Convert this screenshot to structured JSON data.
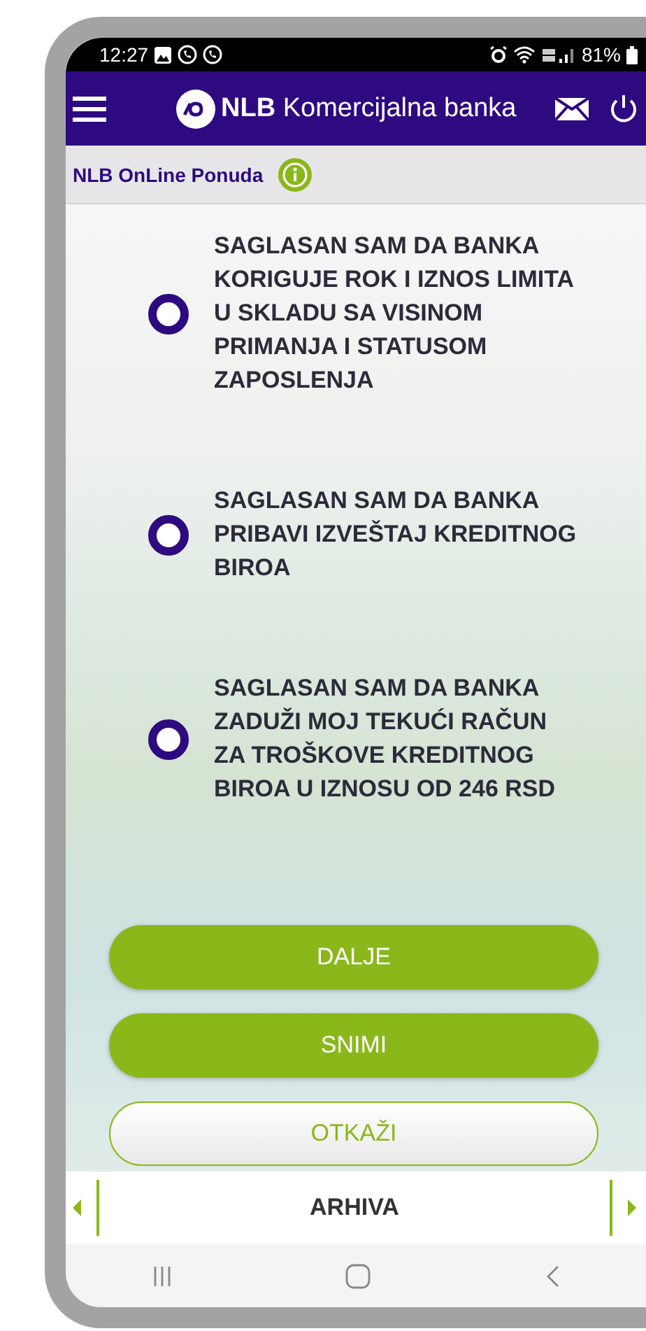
{
  "status_bar": {
    "time": "12:27",
    "battery": "81%"
  },
  "header": {
    "title": "**NLB** Komercijalna banka"
  },
  "subheader": {
    "title": "NLB OnLine Ponuda"
  },
  "consents": [
    {
      "text": "SAGLASAN SAM DA BANKA KORIGUJE ROK I IZNOS LIMITA U SKLADU SA VISINOM PRIMANJA I STATUSOM ZAPOSLENJA",
      "selected": false
    },
    {
      "text": "SAGLASAN SAM DA BANKA PRIBAVI IZVEŠTAJ KREDITNOG BIROA",
      "selected": false
    },
    {
      "text": "SAGLASAN SAM DA BANKA ZADUŽI MOJ TEKUĆI RAČUN ZA TROŠKOVE KREDITNOG BIROA U IZNOSU OD 246 RSD",
      "selected": false
    }
  ],
  "buttons": [
    {
      "label": "DALJE",
      "kind": "primary"
    },
    {
      "label": "SNIMI",
      "kind": "primary"
    },
    {
      "label": "OTKAŽI",
      "kind": "secondary"
    }
  ],
  "bottom_bar": {
    "label": "ARHIVA"
  }
}
